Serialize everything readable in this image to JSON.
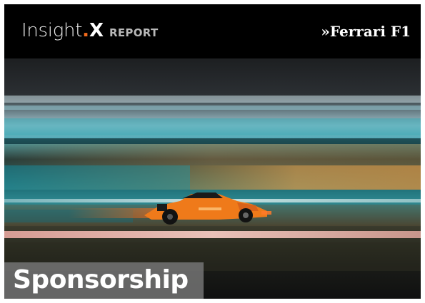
{
  "header": {
    "brand_name": "Insight",
    "brand_dot": ".",
    "brand_x": "X",
    "brand_report": "REPORT",
    "section_tag": "»Ferrari F1"
  },
  "photo": {
    "subject": "race-car-motion-blur-photo"
  },
  "badge": {
    "label": "Sponsorship"
  },
  "colors": {
    "accent": "#f26a1b",
    "header_bg": "#000000",
    "badge_bg": "#787878",
    "car_orange": "#ef7a1a"
  }
}
